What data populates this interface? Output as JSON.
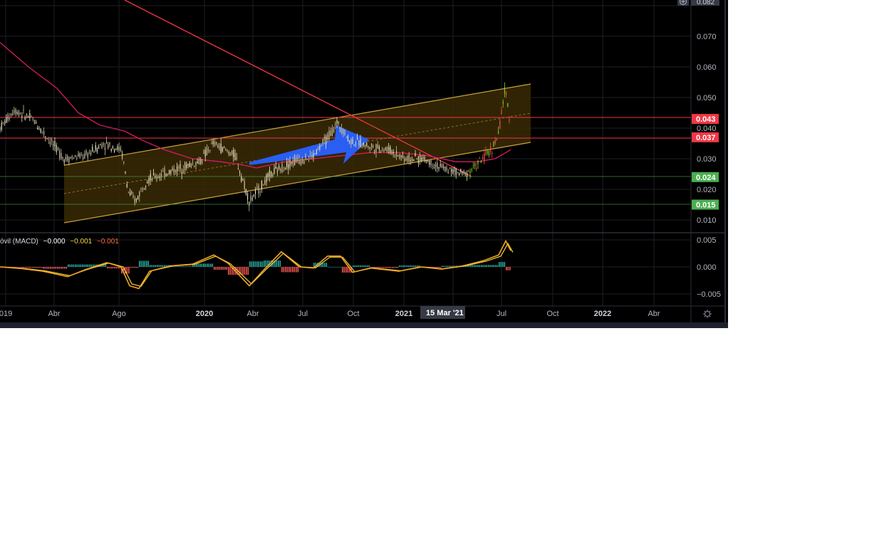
{
  "price_scale": {
    "top_value": "0.082",
    "ticks": [
      "0.070",
      "0.060",
      "0.050",
      "0.040",
      "0.030",
      "0.020",
      "0.010"
    ]
  },
  "level_badges": [
    {
      "label": "0.043",
      "color": "#f23645",
      "value": 0.043
    },
    {
      "label": "0.037",
      "color": "#f23645",
      "value": 0.037
    },
    {
      "label": "0.024",
      "color": "#4caf50",
      "value": 0.024
    },
    {
      "label": "0.015",
      "color": "#4caf50",
      "value": 0.015
    }
  ],
  "macd": {
    "legend_name": "óvil (MACD)",
    "legend_values": [
      "−0.000",
      "−0.001",
      "−0.001"
    ],
    "scale_ticks": [
      "0.005",
      "0.000",
      "−0.005"
    ]
  },
  "time_axis": {
    "labels": [
      "019",
      "Abr",
      "Ago",
      "2020",
      "Abr",
      "Jul",
      "Oct",
      "2021",
      "Jul",
      "Oct",
      "2022",
      "Abr"
    ],
    "bold_labels": [
      "2020",
      "2021",
      "2022"
    ],
    "cursor_label": "15 Mar '21"
  },
  "icons": {
    "settings": "gear-icon",
    "top_button": "plus-icon"
  },
  "colors": {
    "background": "#000000",
    "channel_fill": "#3a2a05",
    "channel_line": "#c9a43a",
    "downtrend": "#f23645",
    "moving_average": "#d81b60",
    "arrow": "#2962ff",
    "macd_line": "#f5a623",
    "signal_line": "#f5d33b"
  }
}
